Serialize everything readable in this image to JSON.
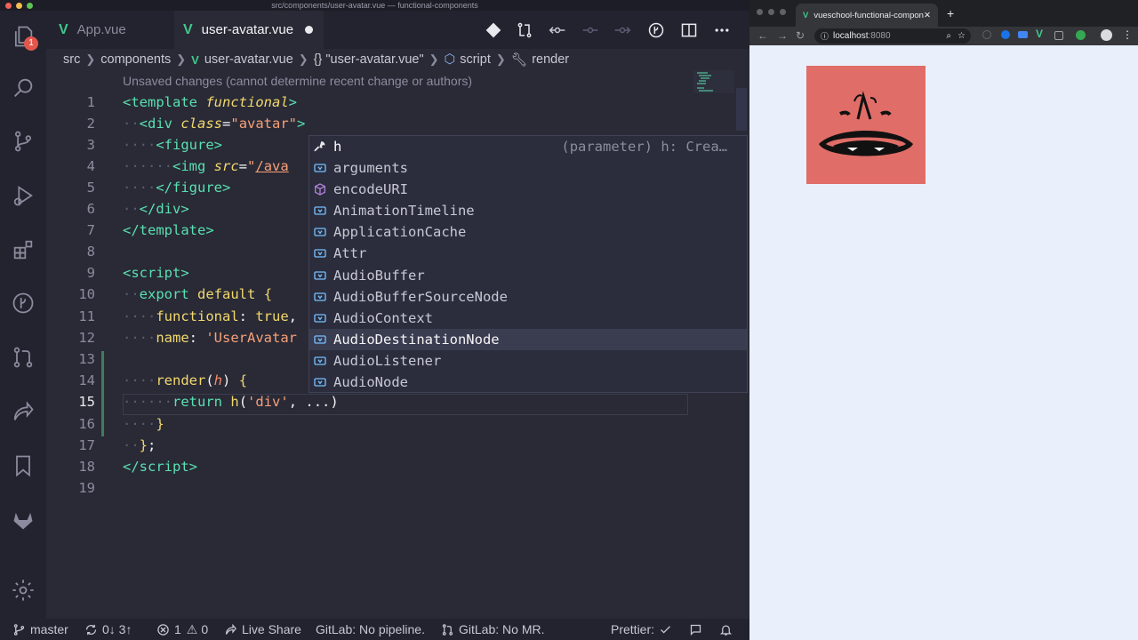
{
  "window": {
    "title": "src/components/user-avatar.vue — functional-components"
  },
  "activity_bar": {
    "badge": "1",
    "items": [
      "files-icon",
      "search-icon",
      "source-control-icon",
      "run-debug-icon",
      "extensions-icon",
      "gitlens-icon",
      "pull-requests-icon",
      "live-share-icon",
      "bookmarks-icon",
      "gitlab-icon",
      "settings-gear-icon"
    ]
  },
  "tabs": [
    {
      "label": "App.vue",
      "active": false
    },
    {
      "label": "user-avatar.vue",
      "active": true,
      "dirty": true
    }
  ],
  "breadcrumb": [
    "src",
    "components",
    "user-avatar.vue",
    "{} \"user-avatar.vue\"",
    "script",
    "render"
  ],
  "editor": {
    "blame_hint": "Unsaved changes (cannot determine recent change or authors)",
    "current_line": "15",
    "line_numbers": [
      "1",
      "2",
      "3",
      "4",
      "5",
      "6",
      "7",
      "8",
      "9",
      "10",
      "11",
      "12",
      "13",
      "14",
      "15",
      "16",
      "17",
      "18",
      "19"
    ]
  },
  "suggest": {
    "detail": "(parameter) h: Crea…",
    "selected": "AudioDestinationNode",
    "items": [
      {
        "label": "h",
        "kind": "wrench-icon"
      },
      {
        "label": "arguments",
        "kind": "variable-icon"
      },
      {
        "label": "encodeURI",
        "kind": "method-cube-icon"
      },
      {
        "label": "AnimationTimeline",
        "kind": "variable-icon"
      },
      {
        "label": "ApplicationCache",
        "kind": "variable-icon"
      },
      {
        "label": "Attr",
        "kind": "variable-icon"
      },
      {
        "label": "AudioBuffer",
        "kind": "variable-icon"
      },
      {
        "label": "AudioBufferSourceNode",
        "kind": "variable-icon"
      },
      {
        "label": "AudioContext",
        "kind": "variable-icon"
      },
      {
        "label": "AudioDestinationNode",
        "kind": "variable-icon"
      },
      {
        "label": "AudioListener",
        "kind": "variable-icon"
      },
      {
        "label": "AudioNode",
        "kind": "variable-icon"
      }
    ]
  },
  "status_bar": {
    "branch": "master",
    "sync": "0↓ 3↑",
    "problems_errors": "1",
    "problems_warnings": "0",
    "live_share": "Live Share",
    "gitlab_pipeline": "GitLab: No pipeline.",
    "gitlab_mr": "GitLab: No MR.",
    "prettier": "Prettier:"
  },
  "browser": {
    "tab_title": "vueschool-functional-compon",
    "url_host": "localhost",
    "url_port": ":8080"
  },
  "colors": {
    "accent": "#5ae0b1",
    "keyword": "#f3d86d",
    "string": "#f7a078",
    "badge": "#e2574c",
    "avatar_bg": "#e06d67"
  }
}
